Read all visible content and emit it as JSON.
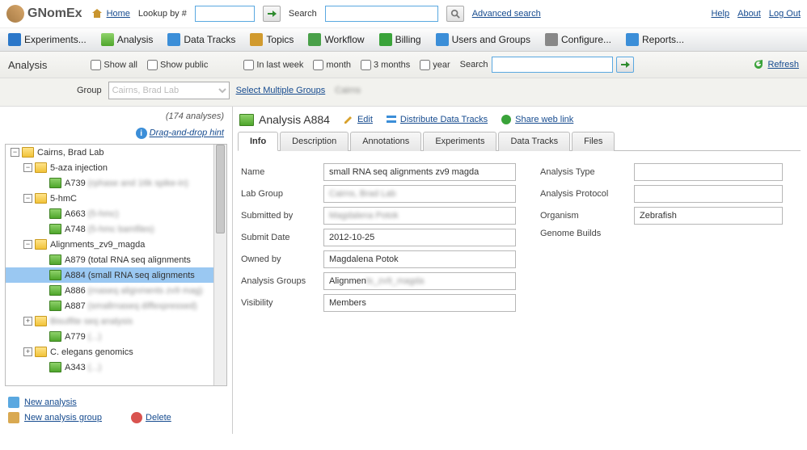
{
  "top": {
    "appName": "GNomEx",
    "home": "Home",
    "lookupLabel": "Lookup by #",
    "searchLabel": "Search",
    "advanced": "Advanced search",
    "help": "Help",
    "about": "About",
    "logout": "Log Out"
  },
  "nav": {
    "experiments": "Experiments...",
    "analysis": "Analysis",
    "dataTracks": "Data Tracks",
    "topics": "Topics",
    "workflow": "Workflow",
    "billing": "Billing",
    "usersGroups": "Users and Groups",
    "configure": "Configure...",
    "reports": "Reports..."
  },
  "filter": {
    "title": "Analysis",
    "showAll": "Show all",
    "showPublic": "Show public",
    "lastWeek": "In last week",
    "month": "month",
    "months3": "3 months",
    "year": "year",
    "searchLabel": "Search",
    "refresh": "Refresh",
    "groupLabel": "Group",
    "groupValue": "Cairns, Brad Lab",
    "selectMultiple": "Select Multiple Groups"
  },
  "left": {
    "count": "(174 analyses)",
    "dnd": "Drag-and-drop hint",
    "newAnalysis": "New analysis",
    "newAnalysisGroup": "New analysis group",
    "delete": "Delete",
    "tree": {
      "root": "Cairns, Brad Lab",
      "g1": "5-aza injection",
      "a739": "A739",
      "g2": "5-hmC",
      "a663": "A663",
      "a748": "A748",
      "g3": "Alignments_zv9_magda",
      "a879": "A879 (total RNA seq alignments",
      "a884": "A884 (small RNA seq alignments",
      "a886": "A886",
      "a887": "A887",
      "g4": "Bisulfite seq analysis",
      "a779": "A779",
      "g5": "C. elegans genomics",
      "a343": "A343"
    }
  },
  "detail": {
    "title": "Analysis A884",
    "edit": "Edit",
    "distribute": "Distribute Data Tracks",
    "share": "Share web link",
    "tabs": {
      "info": "Info",
      "desc": "Description",
      "anno": "Annotations",
      "exp": "Experiments",
      "dt": "Data Tracks",
      "files": "Files"
    },
    "labels": {
      "name": "Name",
      "labGroup": "Lab Group",
      "submittedBy": "Submitted by",
      "submitDate": "Submit Date",
      "ownedBy": "Owned by",
      "analysisGroups": "Analysis Groups",
      "visibility": "Visibility",
      "analysisType": "Analysis Type",
      "analysisProtocol": "Analysis Protocol",
      "organism": "Organism",
      "genomeBuilds": "Genome Builds"
    },
    "values": {
      "name": "small RNA seq alignments zv9 magda",
      "labGroup": "Cairns, Brad Lab",
      "submittedBy": "Magdalena Potok",
      "submitDate": "2012-10-25",
      "ownedBy": "Magdalena Potok",
      "analysisGroups": "Alignments_zv9_magda",
      "visibility": "Members",
      "organism": "Zebrafish"
    }
  }
}
